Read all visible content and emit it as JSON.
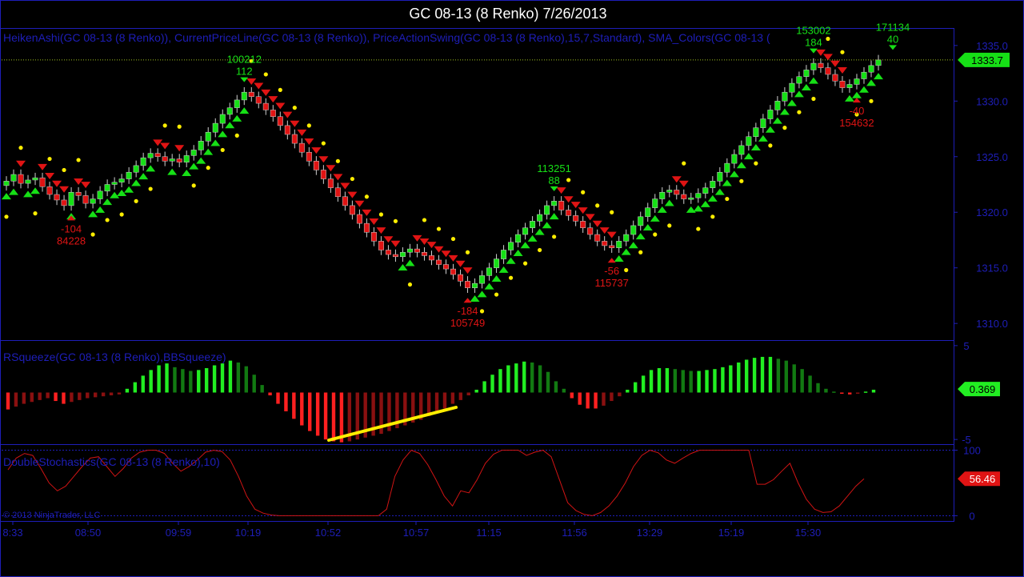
{
  "title": "GC 08-13 (8 Renko)  7/26/2013",
  "copyright": "© 2013 NinjaTrader, LLC",
  "colors": {
    "up": "#16e016",
    "down": "#e01414",
    "dot": "#ffee00",
    "axis": "#1e1eb8",
    "swing_up_label": "#16e016",
    "swing_down_label": "#e01414",
    "current_price_bg": "#16e016",
    "stoch_line": "#d01414"
  },
  "chart_data": [
    {
      "type": "candlestick",
      "panel": "price",
      "indicator_label": "HeikenAshi(GC 08-13 (8 Renko)), CurrentPriceLine(GC 08-13 (8 Renko)), PriceActionSwing(GC 08-13 (8 Renko),15,7,Standard), SMA_Colors(GC 08-13 (",
      "ylim": [
        1308.5,
        1336.5
      ],
      "yticks": [
        1310.0,
        1315.0,
        1320.0,
        1325.0,
        1330.0,
        1335.0
      ],
      "ytick_labels": [
        "1310.0",
        "1315.0",
        "1320.0",
        "1325.0",
        "1330.0",
        "1335.0"
      ],
      "current_price": 1333.7,
      "current_price_label": "1333.7",
      "closes": [
        1322.8,
        1323.4,
        1322.6,
        1322.9,
        1323.1,
        1322.3,
        1321.6,
        1321.1,
        1320.6,
        1321.8,
        1321.5,
        1320.8,
        1321.2,
        1321.9,
        1322.5,
        1322.7,
        1323.0,
        1323.6,
        1324.2,
        1324.9,
        1325.3,
        1325.0,
        1324.6,
        1324.8,
        1324.5,
        1325.1,
        1325.6,
        1326.4,
        1327.2,
        1328.0,
        1328.8,
        1329.4,
        1330.1,
        1330.8,
        1330.4,
        1329.8,
        1329.2,
        1328.6,
        1327.8,
        1327.0,
        1326.2,
        1325.4,
        1324.6,
        1323.8,
        1323.0,
        1322.2,
        1321.4,
        1320.6,
        1319.8,
        1319.0,
        1318.2,
        1317.4,
        1316.6,
        1316.2,
        1316.0,
        1316.4,
        1316.7,
        1316.4,
        1316.1,
        1315.7,
        1315.3,
        1314.9,
        1314.4,
        1313.8,
        1313.2,
        1313.6,
        1314.3,
        1315.0,
        1315.8,
        1316.6,
        1317.3,
        1318.0,
        1318.6,
        1319.2,
        1319.8,
        1320.6,
        1321.0,
        1320.2,
        1319.7,
        1319.2,
        1318.6,
        1318.0,
        1317.4,
        1317.0,
        1316.8,
        1317.4,
        1318.0,
        1318.8,
        1319.6,
        1320.4,
        1321.2,
        1321.8,
        1322.0,
        1321.6,
        1321.2,
        1321.3,
        1321.7,
        1322.2,
        1322.8,
        1323.6,
        1324.4,
        1325.2,
        1326.0,
        1326.8,
        1327.6,
        1328.4,
        1329.2,
        1330.0,
        1330.8,
        1331.6,
        1332.2,
        1332.8,
        1333.4,
        1333.0,
        1332.4,
        1331.8,
        1331.2,
        1331.5,
        1332.0,
        1332.6,
        1333.2,
        1333.7
      ],
      "swings": [
        {
          "type": "low",
          "index": 9,
          "price": 1320.6,
          "labels": [
            "-104",
            "84228"
          ]
        },
        {
          "type": "high",
          "index": 33,
          "price": 1330.8,
          "labels": [
            "100212",
            "112"
          ]
        },
        {
          "type": "low",
          "index": 64,
          "price": 1313.2,
          "labels": [
            "-184",
            "105749"
          ]
        },
        {
          "type": "high",
          "index": 76,
          "price": 1321.0,
          "labels": [
            "113251",
            "88"
          ]
        },
        {
          "type": "low",
          "index": 84,
          "price": 1316.8,
          "labels": [
            "-56",
            "115737"
          ]
        },
        {
          "type": "high",
          "index": 112,
          "price": 1333.4,
          "labels": [
            "153002",
            "184"
          ]
        },
        {
          "type": "low",
          "index": 118,
          "price": 1331.2,
          "labels": [
            "-40",
            "154632"
          ]
        },
        {
          "type": "high",
          "index": 123,
          "price": 1333.7,
          "labels": [
            "171134",
            "40"
          ]
        }
      ]
    },
    {
      "type": "bar",
      "panel": "squeeze",
      "indicator_label": "RSqueeze(GC 08-13 (8 Renko),BBSqueeze)",
      "ylim": [
        -5.5,
        5.5
      ],
      "yticks": [
        5,
        -5
      ],
      "ytick_labels": [
        "5",
        "-5"
      ],
      "current_value_label": "0.369",
      "values": [
        -1.8,
        -1.5,
        -1.2,
        -1.0,
        -0.8,
        -0.6,
        -0.9,
        -1.2,
        -1.0,
        -0.8,
        -0.6,
        -0.5,
        -0.4,
        -0.3,
        -0.2,
        0.4,
        1.1,
        1.8,
        2.4,
        2.9,
        3.1,
        2.7,
        2.5,
        2.3,
        2.4,
        2.6,
        2.9,
        3.1,
        3.4,
        3.2,
        2.8,
        1.9,
        0.8,
        -0.3,
        -1.2,
        -2.0,
        -2.8,
        -3.5,
        -4.1,
        -4.6,
        -5.0,
        -5.2,
        -5.3,
        -5.2,
        -5.0,
        -4.8,
        -4.6,
        -4.4,
        -4.1,
        -3.8,
        -3.5,
        -3.2,
        -2.9,
        -2.5,
        -2.1,
        -1.7,
        -1.2,
        -0.8,
        -0.3,
        0.3,
        1.2,
        1.9,
        2.5,
        2.9,
        3.1,
        3.3,
        3.2,
        2.9,
        2.2,
        1.2,
        0.4,
        -0.6,
        -1.3,
        -1.7,
        -1.7,
        -1.4,
        -0.9,
        -0.4,
        0.3,
        1.1,
        1.8,
        2.4,
        2.6,
        2.6,
        2.5,
        2.4,
        2.3,
        2.3,
        2.4,
        2.5,
        2.7,
        2.9,
        3.2,
        3.5,
        3.7,
        3.8,
        3.8,
        3.6,
        3.4,
        3.0,
        2.5,
        1.8,
        1.0,
        0.4,
        0.1,
        -0.1,
        -0.2,
        -0.1,
        0.1,
        0.3
      ]
    },
    {
      "type": "line",
      "panel": "stochastics",
      "indicator_label": "DoubleStochastics(GC 08-13 (8 Renko),10)",
      "ylim": [
        -8,
        108
      ],
      "yticks": [
        100,
        0
      ],
      "ytick_labels": [
        "100",
        "0"
      ],
      "current_value_label": "56.46",
      "values": [
        70,
        88,
        95,
        92,
        72,
        50,
        38,
        45,
        60,
        75,
        88,
        90,
        75,
        60,
        72,
        88,
        97,
        100,
        100,
        95,
        80,
        68,
        75,
        85,
        97,
        100,
        98,
        85,
        60,
        30,
        10,
        4,
        1,
        0,
        0,
        0,
        0,
        0,
        0,
        0,
        0,
        0,
        0,
        0,
        0,
        0,
        10,
        60,
        85,
        100,
        95,
        78,
        55,
        30,
        15,
        38,
        35,
        55,
        80,
        94,
        100,
        100,
        100,
        92,
        97,
        100,
        90,
        55,
        20,
        8,
        2,
        0,
        5,
        15,
        30,
        50,
        75,
        92,
        100,
        96,
        85,
        80,
        88,
        95,
        100,
        100,
        100,
        100,
        100,
        100,
        100,
        48,
        48,
        55,
        68,
        80,
        50,
        25,
        10,
        5,
        6,
        15,
        30,
        45,
        56.46
      ]
    }
  ],
  "x_axis": {
    "tick_labels": [
      "8:33",
      "08:50",
      "09:59",
      "10:19",
      "10:52",
      "10:57",
      "11:15",
      "11:56",
      "13:29",
      "15:19",
      "15:30"
    ]
  }
}
